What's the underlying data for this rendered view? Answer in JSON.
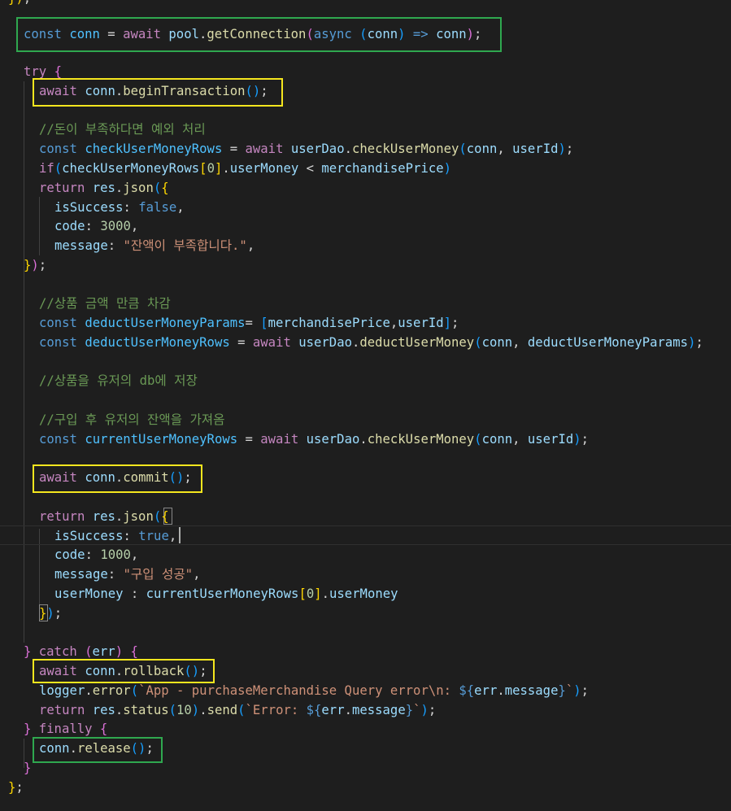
{
  "editor": {
    "colors": {
      "background": "#1e1e1e",
      "keyword_control": "#c586c0",
      "keyword_storage": "#569cd6",
      "variable": "#9cdcfe",
      "constant": "#4fc1ff",
      "function": "#dcdcaa",
      "string": "#ce9178",
      "number": "#b5cea8",
      "comment": "#6a9955",
      "highlight_yellow": "#f5e61e",
      "highlight_green": "#2fa84f"
    },
    "lines": [
      {
        "tokens": [
          [
            "})",
            "br"
          ],
          [
            ";",
            "pl"
          ]
        ]
      },
      {
        "tokens": []
      },
      {
        "tokens": [
          [
            "const ",
            "st"
          ],
          [
            "conn",
            "cst"
          ],
          [
            " = ",
            "op"
          ],
          [
            "await ",
            "kw"
          ],
          [
            "pool",
            "var"
          ],
          [
            ".",
            "pl"
          ],
          [
            "getConnection",
            "fn"
          ],
          [
            "(",
            "brp"
          ],
          [
            "async ",
            "st"
          ],
          [
            "(",
            "brb"
          ],
          [
            "conn",
            "var"
          ],
          [
            ")",
            "brb"
          ],
          [
            " => ",
            "st"
          ],
          [
            "conn",
            "var"
          ],
          [
            ")",
            "brp"
          ],
          [
            ";",
            "pl"
          ]
        ]
      },
      {
        "tokens": []
      },
      {
        "tokens": [
          [
            "try ",
            "kw"
          ],
          [
            "{",
            "brp"
          ]
        ]
      },
      {
        "tokens": [
          [
            "await ",
            "kw"
          ],
          [
            "conn",
            "var"
          ],
          [
            ".",
            "pl"
          ],
          [
            "beginTransaction",
            "fn"
          ],
          [
            "()",
            "brb"
          ],
          [
            ";",
            "pl"
          ]
        ]
      },
      {
        "tokens": []
      },
      {
        "tokens": [
          [
            "//돈이 부족하다면 예외 처리",
            "cmt"
          ]
        ]
      },
      {
        "tokens": [
          [
            "const ",
            "st"
          ],
          [
            "checkUserMoneyRows",
            "cst"
          ],
          [
            " = ",
            "op"
          ],
          [
            "await ",
            "kw"
          ],
          [
            "userDao",
            "var"
          ],
          [
            ".",
            "pl"
          ],
          [
            "checkUserMoney",
            "fn"
          ],
          [
            "(",
            "brb"
          ],
          [
            "conn",
            "var"
          ],
          [
            ", ",
            "pl"
          ],
          [
            "userId",
            "var"
          ],
          [
            ")",
            "brb"
          ],
          [
            ";",
            "pl"
          ]
        ]
      },
      {
        "tokens": [
          [
            "if",
            "kw"
          ],
          [
            "(",
            "brb"
          ],
          [
            "checkUserMoneyRows",
            "var"
          ],
          [
            "[",
            "br"
          ],
          [
            "0",
            "num"
          ],
          [
            "]",
            "br"
          ],
          [
            ".",
            "pl"
          ],
          [
            "userMoney",
            "var"
          ],
          [
            " < ",
            "op"
          ],
          [
            "merchandisePrice",
            "var"
          ],
          [
            ")",
            "brb"
          ]
        ]
      },
      {
        "tokens": [
          [
            "return ",
            "kw"
          ],
          [
            "res",
            "var"
          ],
          [
            ".",
            "pl"
          ],
          [
            "json",
            "fn"
          ],
          [
            "(",
            "brb"
          ],
          [
            "{",
            "br"
          ]
        ]
      },
      {
        "tokens": [
          [
            "isSuccess",
            "var"
          ],
          [
            ": ",
            "pl"
          ],
          [
            "false",
            "st"
          ],
          [
            ",",
            "pl"
          ]
        ]
      },
      {
        "tokens": [
          [
            "code",
            "var"
          ],
          [
            ": ",
            "pl"
          ],
          [
            "3000",
            "num"
          ],
          [
            ",",
            "pl"
          ]
        ]
      },
      {
        "tokens": [
          [
            "message",
            "var"
          ],
          [
            ": ",
            "pl"
          ],
          [
            "\"잔액이 부족합니다.\"",
            "str"
          ],
          [
            ",",
            "pl"
          ]
        ]
      },
      {
        "tokens": [
          [
            "}",
            "br"
          ],
          [
            ")",
            "brp"
          ],
          [
            ";",
            "pl"
          ]
        ]
      },
      {
        "tokens": []
      },
      {
        "tokens": [
          [
            "//상품 금액 만큼 차감",
            "cmt"
          ]
        ]
      },
      {
        "tokens": [
          [
            "const ",
            "st"
          ],
          [
            "deductUserMoneyParams",
            "cst"
          ],
          [
            "= ",
            "op"
          ],
          [
            "[",
            "brb"
          ],
          [
            "merchandisePrice",
            "var"
          ],
          [
            ",",
            "pl"
          ],
          [
            "userId",
            "var"
          ],
          [
            "]",
            "brb"
          ],
          [
            ";",
            "pl"
          ]
        ]
      },
      {
        "tokens": [
          [
            "const ",
            "st"
          ],
          [
            "deductUserMoneyRows",
            "cst"
          ],
          [
            " = ",
            "op"
          ],
          [
            "await ",
            "kw"
          ],
          [
            "userDao",
            "var"
          ],
          [
            ".",
            "pl"
          ],
          [
            "deductUserMoney",
            "fn"
          ],
          [
            "(",
            "brb"
          ],
          [
            "conn",
            "var"
          ],
          [
            ", ",
            "pl"
          ],
          [
            "deductUserMoneyParams",
            "var"
          ],
          [
            ")",
            "brb"
          ],
          [
            ";",
            "pl"
          ]
        ]
      },
      {
        "tokens": []
      },
      {
        "tokens": [
          [
            "//상품을 유저의 db에 저장",
            "cmt"
          ]
        ]
      },
      {
        "tokens": []
      },
      {
        "tokens": [
          [
            "//구입 후 유저의 잔액을 가져옴",
            "cmt"
          ]
        ]
      },
      {
        "tokens": [
          [
            "const ",
            "st"
          ],
          [
            "currentUserMoneyRows",
            "cst"
          ],
          [
            " = ",
            "op"
          ],
          [
            "await ",
            "kw"
          ],
          [
            "userDao",
            "var"
          ],
          [
            ".",
            "pl"
          ],
          [
            "checkUserMoney",
            "fn"
          ],
          [
            "(",
            "brb"
          ],
          [
            "conn",
            "var"
          ],
          [
            ", ",
            "pl"
          ],
          [
            "userId",
            "var"
          ],
          [
            ")",
            "brb"
          ],
          [
            ";",
            "pl"
          ]
        ]
      },
      {
        "tokens": []
      },
      {
        "tokens": [
          [
            "await ",
            "kw"
          ],
          [
            "conn",
            "var"
          ],
          [
            ".",
            "pl"
          ],
          [
            "commit",
            "fn"
          ],
          [
            "()",
            "brb"
          ],
          [
            ";",
            "pl"
          ]
        ]
      },
      {
        "tokens": []
      },
      {
        "tokens": [
          [
            "return ",
            "kw"
          ],
          [
            "res",
            "var"
          ],
          [
            ".",
            "pl"
          ],
          [
            "json",
            "fn"
          ],
          [
            "(",
            "brb"
          ],
          [
            "{",
            "br"
          ]
        ]
      },
      {
        "tokens": [
          [
            "isSuccess",
            "var"
          ],
          [
            ": ",
            "pl"
          ],
          [
            "true",
            "st"
          ],
          [
            ",",
            "pl"
          ]
        ]
      },
      {
        "tokens": [
          [
            "code",
            "var"
          ],
          [
            ": ",
            "pl"
          ],
          [
            "1000",
            "num"
          ],
          [
            ",",
            "pl"
          ]
        ]
      },
      {
        "tokens": [
          [
            "message",
            "var"
          ],
          [
            ": ",
            "pl"
          ],
          [
            "\"구입 성공\"",
            "str"
          ],
          [
            ",",
            "pl"
          ]
        ]
      },
      {
        "tokens": [
          [
            "userMoney",
            "var"
          ],
          [
            " : ",
            "pl"
          ],
          [
            "currentUserMoneyRows",
            "var"
          ],
          [
            "[",
            "br"
          ],
          [
            "0",
            "num"
          ],
          [
            "]",
            "br"
          ],
          [
            ".",
            "pl"
          ],
          [
            "userMoney",
            "var"
          ]
        ]
      },
      {
        "tokens": [
          [
            "}",
            "br"
          ],
          [
            ")",
            "brb"
          ],
          [
            ";",
            "pl"
          ]
        ]
      },
      {
        "tokens": []
      },
      {
        "tokens": [
          [
            "} ",
            "brp"
          ],
          [
            "catch ",
            "kw"
          ],
          [
            "(",
            "brp"
          ],
          [
            "err",
            "var"
          ],
          [
            ") ",
            "brp"
          ],
          [
            "{",
            "brp"
          ]
        ]
      },
      {
        "tokens": [
          [
            "await ",
            "kw"
          ],
          [
            "conn",
            "var"
          ],
          [
            ".",
            "pl"
          ],
          [
            "rollback",
            "fn"
          ],
          [
            "()",
            "brb"
          ],
          [
            ";",
            "pl"
          ]
        ]
      },
      {
        "tokens": [
          [
            "logger",
            "var"
          ],
          [
            ".",
            "pl"
          ],
          [
            "error",
            "fn"
          ],
          [
            "(",
            "brb"
          ],
          [
            "`App - purchaseMerchandise Query error\\n: ",
            "str"
          ],
          [
            "${",
            "st"
          ],
          [
            "err",
            "var"
          ],
          [
            ".",
            "pl"
          ],
          [
            "message",
            "var"
          ],
          [
            "}",
            "st"
          ],
          [
            "`",
            "str"
          ],
          [
            ")",
            "brb"
          ],
          [
            ";",
            "pl"
          ]
        ]
      },
      {
        "tokens": [
          [
            "return ",
            "kw"
          ],
          [
            "res",
            "var"
          ],
          [
            ".",
            "pl"
          ],
          [
            "status",
            "fn"
          ],
          [
            "(",
            "brb"
          ],
          [
            "10",
            "num"
          ],
          [
            ")",
            "brb"
          ],
          [
            ".",
            "pl"
          ],
          [
            "send",
            "fn"
          ],
          [
            "(",
            "brb"
          ],
          [
            "`Error: ",
            "str"
          ],
          [
            "${",
            "st"
          ],
          [
            "err",
            "var"
          ],
          [
            ".",
            "pl"
          ],
          [
            "message",
            "var"
          ],
          [
            "}",
            "st"
          ],
          [
            "`",
            "str"
          ],
          [
            ")",
            "brb"
          ],
          [
            ";",
            "pl"
          ]
        ]
      },
      {
        "tokens": [
          [
            "} ",
            "brp"
          ],
          [
            "finally ",
            "kw"
          ],
          [
            "{",
            "brp"
          ]
        ]
      },
      {
        "tokens": [
          [
            "conn",
            "var"
          ],
          [
            ".",
            "pl"
          ],
          [
            "release",
            "fn"
          ],
          [
            "()",
            "brb"
          ],
          [
            ";",
            "pl"
          ]
        ]
      },
      {
        "tokens": [
          [
            "}",
            "brp"
          ]
        ]
      },
      {
        "tokens": [
          [
            "}",
            "br"
          ],
          [
            ";",
            "pl"
          ]
        ]
      }
    ]
  }
}
